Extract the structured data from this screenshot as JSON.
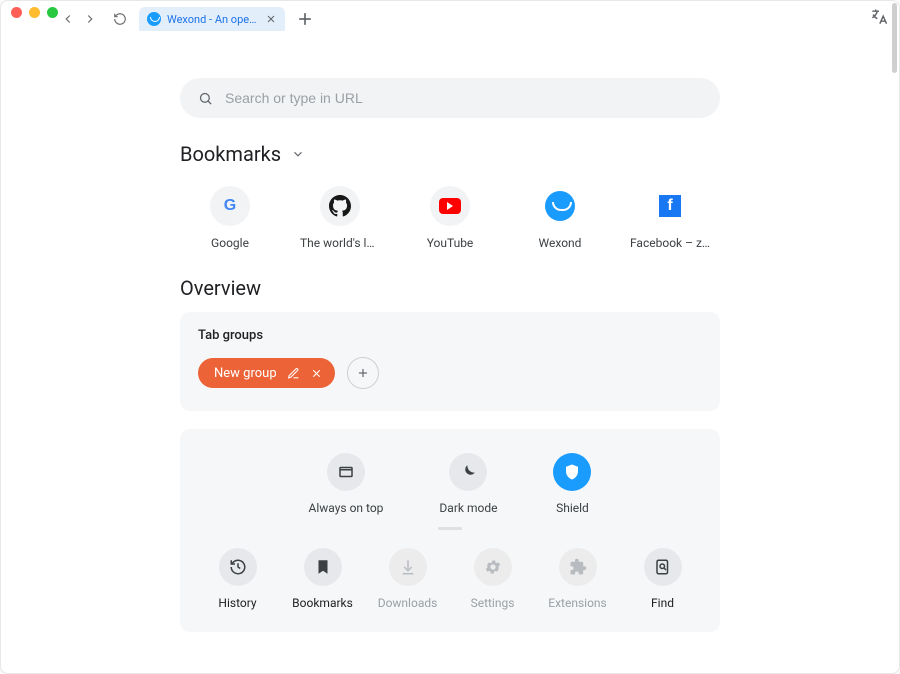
{
  "tab": {
    "title": "Wexond - An open-…"
  },
  "search": {
    "placeholder": "Search or type in URL"
  },
  "bookmarks": {
    "header": "Bookmarks",
    "items": [
      {
        "label": "Google",
        "icon": "google-icon"
      },
      {
        "label": "The world's lead…",
        "icon": "github-icon"
      },
      {
        "label": "YouTube",
        "icon": "youtube-icon"
      },
      {
        "label": "Wexond",
        "icon": "wexond-icon"
      },
      {
        "label": "Facebook – zal…",
        "icon": "facebook-icon"
      }
    ]
  },
  "overview": {
    "header": "Overview"
  },
  "tab_groups": {
    "title": "Tab groups",
    "group": {
      "name": "New group"
    }
  },
  "quick": [
    {
      "name": "always-on-top",
      "label": "Always on top",
      "icon": "window-icon",
      "active": false
    },
    {
      "name": "dark-mode",
      "label": "Dark mode",
      "icon": "moon-icon",
      "active": false
    },
    {
      "name": "shield",
      "label": "Shield",
      "icon": "shield-icon",
      "active": true
    }
  ],
  "tools": [
    {
      "name": "history",
      "label": "History",
      "icon": "history-icon",
      "dim": false
    },
    {
      "name": "bookmarks",
      "label": "Bookmarks",
      "icon": "bookmark-icon",
      "dim": false
    },
    {
      "name": "downloads",
      "label": "Downloads",
      "icon": "download-icon",
      "dim": true
    },
    {
      "name": "settings",
      "label": "Settings",
      "icon": "gear-icon",
      "dim": true
    },
    {
      "name": "extensions",
      "label": "Extensions",
      "icon": "puzzle-icon",
      "dim": true
    },
    {
      "name": "find",
      "label": "Find",
      "icon": "find-icon",
      "dim": false
    }
  ]
}
